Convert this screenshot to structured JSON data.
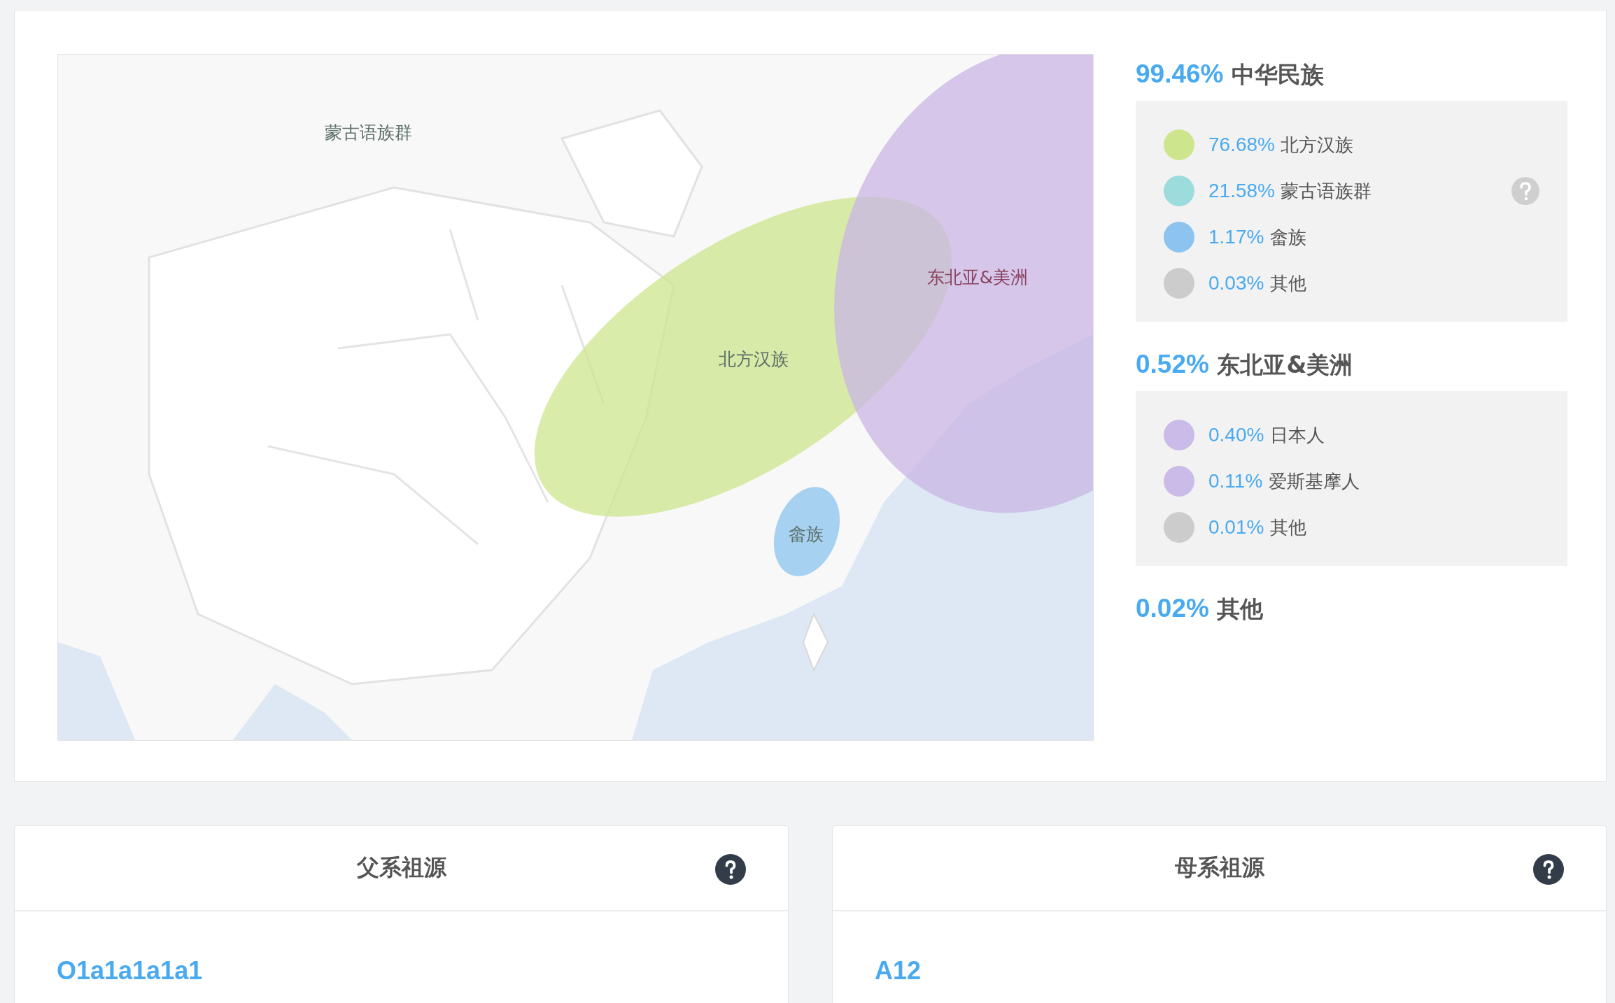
{
  "map": {
    "regions": [
      {
        "label": "蒙古语族群"
      },
      {
        "label": "北方汉族"
      },
      {
        "label": "东北亚&美洲"
      },
      {
        "label": "畲族"
      }
    ]
  },
  "groups": [
    {
      "percent": "99.46%",
      "name": "中华民族",
      "items": [
        {
          "percent": "76.68%",
          "name": "北方汉族",
          "color": "#cde68e",
          "help": false
        },
        {
          "percent": "21.58%",
          "name": "蒙古语族群",
          "color": "#9ddcdc",
          "help": true
        },
        {
          "percent": "1.17%",
          "name": "畲族",
          "color": "#8cc4ef",
          "help": false
        },
        {
          "percent": "0.03%",
          "name": "其他",
          "color": "#cccccc",
          "help": false
        }
      ]
    },
    {
      "percent": "0.52%",
      "name": "东北亚&美洲",
      "items": [
        {
          "percent": "0.40%",
          "name": "日本人",
          "color": "#cbbbe8",
          "help": false
        },
        {
          "percent": "0.11%",
          "name": "爱斯基摩人",
          "color": "#cbbbe8",
          "help": false
        },
        {
          "percent": "0.01%",
          "name": "其他",
          "color": "#cccccc",
          "help": false
        }
      ]
    },
    {
      "percent": "0.02%",
      "name": "其他"
    }
  ],
  "lineages": [
    {
      "title": "父系祖源",
      "haplogroup": "O1a1a1a1a1"
    },
    {
      "title": "母系祖源",
      "haplogroup": "A12"
    }
  ]
}
